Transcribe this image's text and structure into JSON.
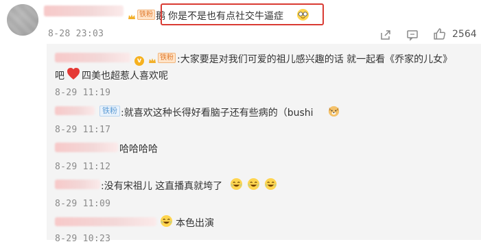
{
  "comment": {
    "tail_char": "鹅",
    "text": "你是不是也有点社交牛逼症",
    "time": "8-28 23:03",
    "like_count": "2564",
    "fan_badge": "铁粉"
  },
  "replies": [
    {
      "badge": "铁粉",
      "line1": ":大家要是对我们可爱的祖儿感兴趣的话 就一起看《乔家的儿女》",
      "line2_prefix": "吧",
      "line2_suffix": "四美也超惹人喜欢呢",
      "time": "8-29 11:19"
    },
    {
      "badge": "铁粉",
      "text": ":就喜欢这种长得好看脑子还有些病的（bushi",
      "time": "8-29 11:17"
    },
    {
      "text": "哈哈哈哈",
      "time": "8-29 11:12"
    },
    {
      "text": ":没有宋祖儿 这直播真就垮了",
      "time": "8-29 11:09"
    },
    {
      "text": "本色出演",
      "time": "8-29 10:23"
    }
  ],
  "icons": {
    "share": "share-icon",
    "comment": "comment-icon",
    "like": "thumbs-up-icon"
  },
  "colors": {
    "highlight": "#d93a32",
    "heart": "#e53935",
    "reply_bg": "#f4f4f4"
  }
}
